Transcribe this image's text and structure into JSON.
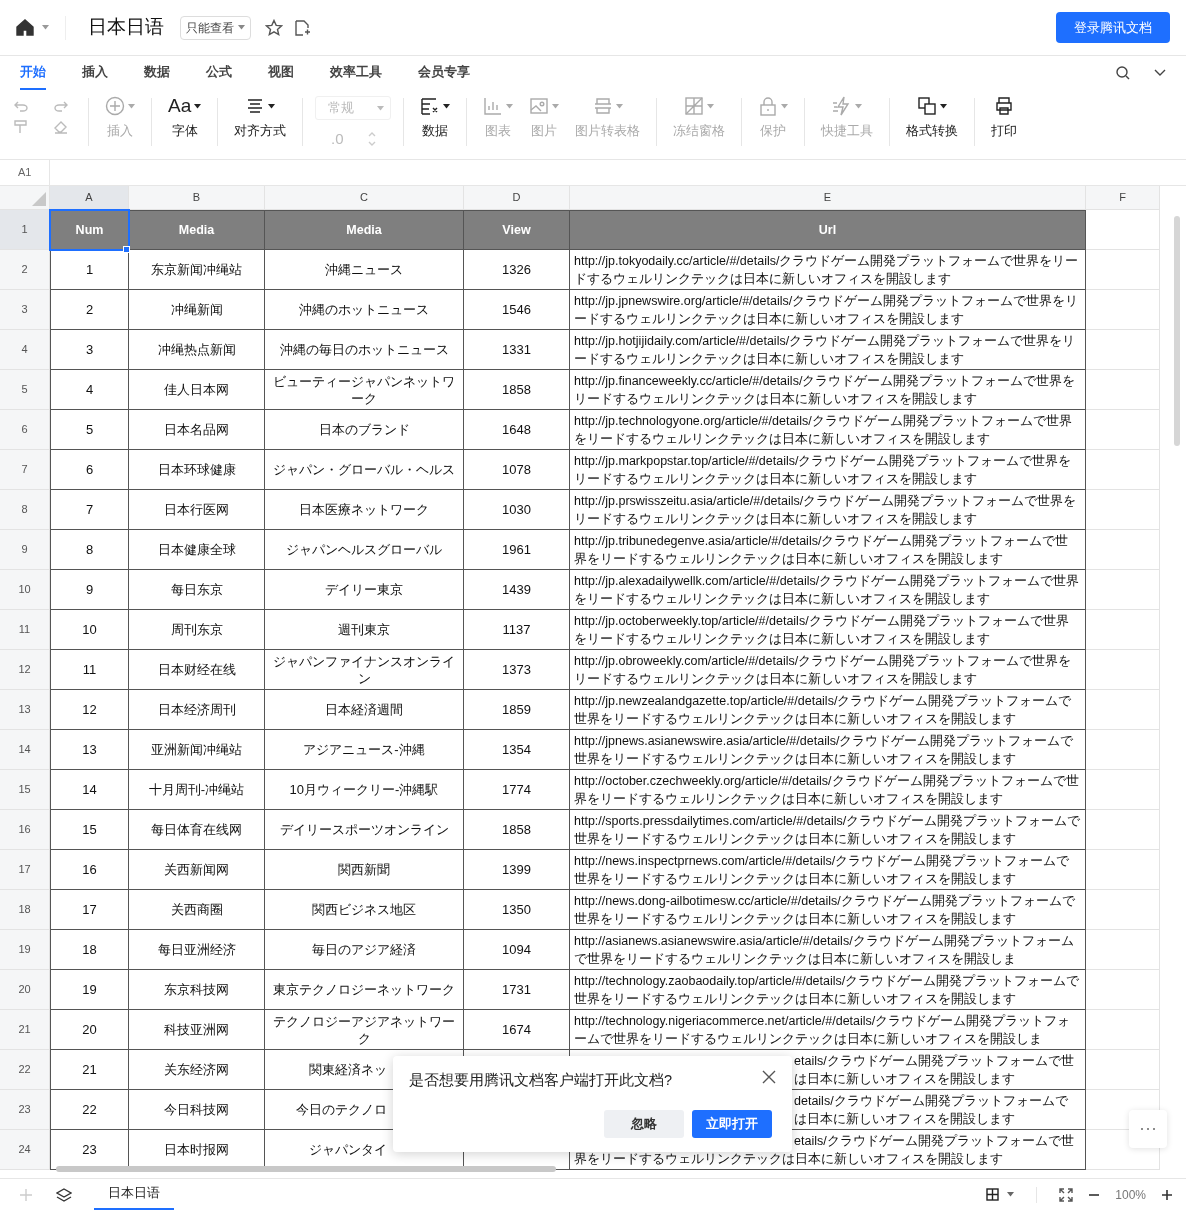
{
  "header": {
    "title": "日本日语",
    "permission": "只能查看",
    "login_button": "登录腾讯文档"
  },
  "menu_tabs": [
    {
      "label": "开始",
      "selected": true
    },
    {
      "label": "插入",
      "selected": false
    },
    {
      "label": "数据",
      "selected": false
    },
    {
      "label": "公式",
      "selected": false
    },
    {
      "label": "视图",
      "selected": false
    },
    {
      "label": "效率工具",
      "selected": false
    },
    {
      "label": "会员专享",
      "selected": false
    }
  ],
  "toolbar": {
    "groups": [
      [
        {
          "kind": "button",
          "label": "插入",
          "disabled": true,
          "dropdown": true
        }
      ],
      [
        {
          "kind": "button",
          "label": "字体",
          "glyph": "Aa",
          "disabled": false,
          "dropdown": true
        }
      ],
      [
        {
          "kind": "button",
          "label": "对齐方式",
          "disabled": false,
          "dropdown": true
        }
      ],
      [
        {
          "kind": "format",
          "value": "常规",
          "decimal": ".0",
          "disabled": true
        }
      ],
      [
        {
          "kind": "button",
          "label": "数据",
          "disabled": false,
          "dropdown": true
        }
      ],
      [
        {
          "kind": "button",
          "label": "图表",
          "disabled": true,
          "dropdown": true
        },
        {
          "kind": "button",
          "label": "图片",
          "disabled": true,
          "dropdown": true
        },
        {
          "kind": "button",
          "label": "图片转表格",
          "disabled": true,
          "dropdown": true
        }
      ],
      [
        {
          "kind": "button",
          "label": "冻结窗格",
          "disabled": true,
          "dropdown": true
        }
      ],
      [
        {
          "kind": "button",
          "label": "保护",
          "disabled": true,
          "dropdown": true
        }
      ],
      [
        {
          "kind": "button",
          "label": "快捷工具",
          "disabled": true,
          "dropdown": true
        }
      ],
      [
        {
          "kind": "button",
          "label": "格式转换",
          "disabled": false,
          "dropdown": true
        }
      ],
      [
        {
          "kind": "button",
          "label": "打印",
          "disabled": false,
          "dropdown": false
        }
      ]
    ]
  },
  "cell_reference": "A1",
  "columns": [
    {
      "label": "A",
      "selected": true
    },
    {
      "label": "B",
      "selected": false
    },
    {
      "label": "C",
      "selected": false
    },
    {
      "label": "D",
      "selected": false
    },
    {
      "label": "E",
      "selected": false
    },
    {
      "label": "F",
      "selected": false
    }
  ],
  "table": {
    "header": {
      "row": "1",
      "selected": true,
      "cells": [
        "Num",
        "Media",
        "Media",
        "View",
        "Url"
      ]
    },
    "rows": [
      {
        "row": "2",
        "num": "1",
        "media_cn": "东京新闻冲绳站",
        "media_jp": "沖縄ニュース",
        "view": "1326",
        "url": "http://jp.tokyodaily.cc/article/#/details/クラウドゲーム開発プラットフォームで世界をリードするウェルリンクテックは日本に新しいオフィスを開設します"
      },
      {
        "row": "3",
        "num": "2",
        "media_cn": "冲绳新闻",
        "media_jp": "沖縄のホットニュース",
        "view": "1546",
        "url": "http://jp.jpnewswire.org/article/#/details/クラウドゲーム開発プラットフォームで世界をリードするウェルリンクテックは日本に新しいオフィスを開設します"
      },
      {
        "row": "4",
        "num": "3",
        "media_cn": "冲绳热点新闻",
        "media_jp": "沖縄の毎日のホットニュース",
        "view": "1331",
        "url": "http://jp.hotjijidaily.com/article/#/details/クラウドゲーム開発プラットフォームで世界をリードするウェルリンクテックは日本に新しいオフィスを開設します"
      },
      {
        "row": "5",
        "num": "4",
        "media_cn": "佳人日本网",
        "media_jp": "ビューティージャパンネットワーク",
        "view": "1858",
        "url": "http://jp.financeweekly.cc/article/#/details/クラウドゲーム開発プラットフォームで世界をリードするウェルリンクテックは日本に新しいオフィスを開設します"
      },
      {
        "row": "6",
        "num": "5",
        "media_cn": "日本名品网",
        "media_jp": "日本のブランド",
        "view": "1648",
        "url": "http://jp.technologyone.org/article/#/details/クラウドゲーム開発プラットフォームで世界をリードするウェルリンクテックは日本に新しいオフィスを開設します"
      },
      {
        "row": "7",
        "num": "6",
        "media_cn": "日本环球健康",
        "media_jp": "ジャパン・グローバル・ヘルス",
        "view": "1078",
        "url": "http://jp.markpopstar.top/article/#/details/クラウドゲーム開発プラットフォームで世界をリードするウェルリンクテックは日本に新しいオフィスを開設します"
      },
      {
        "row": "8",
        "num": "7",
        "media_cn": "日本行医网",
        "media_jp": "日本医療ネットワーク",
        "view": "1030",
        "url": "http://jp.prswisszeitu.asia/article/#/details/クラウドゲーム開発プラットフォームで世界をリードするウェルリンクテックは日本に新しいオフィスを開設します"
      },
      {
        "row": "9",
        "num": "8",
        "media_cn": "日本健康全球",
        "media_jp": "ジャパンヘルスグローバル",
        "view": "1961",
        "url": "http://jp.tribunedegenve.asia/article/#/details/クラウドゲーム開発プラットフォームで世界をリードするウェルリンクテックは日本に新しいオフィスを開設します"
      },
      {
        "row": "10",
        "num": "9",
        "media_cn": "每日东京",
        "media_jp": "デイリー東京",
        "view": "1439",
        "url": "http://jp.alexadailywellk.com/article/#/details/クラウドゲーム開発プラットフォームで世界をリードするウェルリンクテックは日本に新しいオフィスを開設します"
      },
      {
        "row": "11",
        "num": "10",
        "media_cn": "周刊东京",
        "media_jp": "週刊東京",
        "view": "1137",
        "url": "http://jp.octoberweekly.top/article/#/details/クラウドゲーム開発プラットフォームで世界をリードするウェルリンクテックは日本に新しいオフィスを開設します"
      },
      {
        "row": "12",
        "num": "11",
        "media_cn": "日本财经在线",
        "media_jp": "ジャパンファイナンスオンライン",
        "view": "1373",
        "url": "http://jp.obroweekly.com/article/#/details/クラウドゲーム開発プラットフォームで世界をリードするウェルリンクテックは日本に新しいオフィスを開設します"
      },
      {
        "row": "13",
        "num": "12",
        "media_cn": "日本经济周刊",
        "media_jp": "日本経済週間",
        "view": "1859",
        "url": "http://jp.newzealandgazette.top/article/#/details/クラウドゲーム開発プラットフォームで世界をリードするウェルリンクテックは日本に新しいオフィスを開設します"
      },
      {
        "row": "14",
        "num": "13",
        "media_cn": "亚洲新闻冲绳站",
        "media_jp": "アジアニュース-沖縄",
        "view": "1354",
        "url": "http://jpnews.asianewswire.asia/article/#/details/クラウドゲーム開発プラットフォームで世界をリードするウェルリンクテックは日本に新しいオフィスを開設します"
      },
      {
        "row": "15",
        "num": "14",
        "media_cn": "十月周刊-冲绳站",
        "media_jp": "10月ウィークリー-沖縄駅",
        "view": "1774",
        "url": "http://october.czechweekly.org/article/#/details/クラウドゲーム開発プラットフォームで世界をリードするウェルリンクテックは日本に新しいオフィスを開設します"
      },
      {
        "row": "16",
        "num": "15",
        "media_cn": "每日体育在线网",
        "media_jp": "デイリースポーツオンライン",
        "view": "1858",
        "url": "http://sports.pressdailytimes.com/article/#/details/クラウドゲーム開発プラットフォームで世界をリードするウェルリンクテックは日本に新しいオフィスを開設します"
      },
      {
        "row": "17",
        "num": "16",
        "media_cn": "关西新闻网",
        "media_jp": "関西新聞",
        "view": "1399",
        "url": "http://news.inspectprnews.com/article/#/details/クラウドゲーム開発プラットフォームで世界をリードするウェルリンクテックは日本に新しいオフィスを開設します"
      },
      {
        "row": "18",
        "num": "17",
        "media_cn": "关西商圈",
        "media_jp": "関西ビジネス地区",
        "view": "1350",
        "url": "http://news.dong-ailbotimesw.cc/article/#/details/クラウドゲーム開発プラットフォームで世界をリードするウェルリンクテックは日本に新しいオフィスを開設します"
      },
      {
        "row": "19",
        "num": "18",
        "media_cn": "每日亚洲经济",
        "media_jp": "毎日のアジア経済",
        "view": "1094",
        "url": "http://asianews.asianewswire.asia/article/#/details/クラウドゲーム開発プラットフォームで世界をリードするウェルリンクテックは日本に新しいオフィスを開設しま"
      },
      {
        "row": "20",
        "num": "19",
        "media_cn": "东京科技网",
        "media_jp": "東京テクノロジーネットワーク",
        "view": "1731",
        "url": "http://technology.zaobaodaily.top/article/#/details/クラウドゲーム開発プラットフォームで世界をリードするウェルリンクテックは日本に新しいオフィスを開設します"
      },
      {
        "row": "21",
        "num": "20",
        "media_cn": "科技亚洲网",
        "media_jp": "テクノロジーアジアネットワーク",
        "view": "1674",
        "url": "http://technology.nigeriacommerce.net/article/#/details/クラウドゲーム開発プラットフォームで世界をリードするウェルリンクテックは日本に新しいオフィスを開設しま"
      },
      {
        "row": "22",
        "num": "21",
        "media_cn": "关东经济网",
        "media_jp": "関東経済ネッ",
        "covered": true,
        "url_parts": [
          {
            "text": "etails/クラウドゲーム開発プラットフォームで世",
            "beside_dialog": true
          },
          {
            "text": "は日本に新しいオフィスを開設します",
            "beside_dialog": true
          }
        ]
      },
      {
        "row": "23",
        "num": "22",
        "media_cn": "今日科技网",
        "media_jp": "今日のテクノロ",
        "covered": true,
        "url_parts": [
          {
            "text": "details/クラウドゲーム開発プラットフォームで",
            "beside_dialog": true
          },
          {
            "text": "は日本に新しいオフィスを開設します",
            "beside_dialog": true
          }
        ]
      },
      {
        "row": "24",
        "num": "23",
        "media_cn": "日本时报网",
        "media_jp": "ジャパンタイ",
        "covered": true,
        "url_parts": [
          {
            "text": "etails/クラウドゲーム開発プラットフォームで世",
            "beside_dialog": true
          },
          {
            "text": "界をリードするウェルリンクテックは日本に新しいオフィスを開設します",
            "beside_dialog": false
          }
        ]
      }
    ]
  },
  "dialog": {
    "message": "是否想要用腾讯文档客户端打开此文档?",
    "buttons": [
      {
        "label": "忽略",
        "primary": false
      },
      {
        "label": "立即打开",
        "primary": true
      }
    ]
  },
  "footer": {
    "sheet_tabs": [
      {
        "label": "日本日语",
        "selected": true
      }
    ],
    "zoom": "100%"
  }
}
